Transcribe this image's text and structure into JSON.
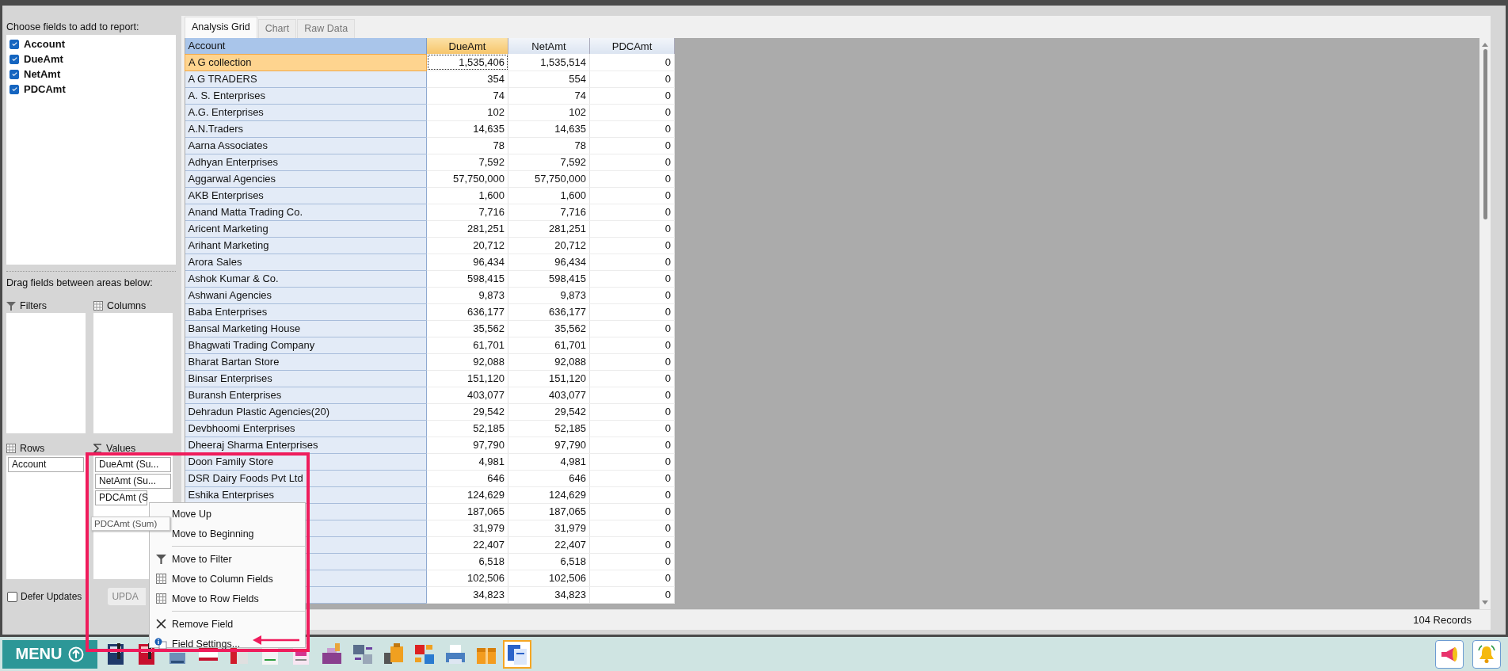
{
  "field_list": {
    "label": "Choose fields to add to report:",
    "fields": [
      {
        "name": "Account",
        "checked": true
      },
      {
        "name": "DueAmt",
        "checked": true
      },
      {
        "name": "NetAmt",
        "checked": true
      },
      {
        "name": "PDCAmt",
        "checked": true
      }
    ]
  },
  "areas_label": "Drag fields between areas below:",
  "areas": {
    "filters": {
      "label": "Filters"
    },
    "columns": {
      "label": "Columns"
    },
    "rows": {
      "label": "Rows",
      "items": [
        "Account"
      ]
    },
    "values": {
      "label": "Values",
      "items": [
        "DueAmt (Su...",
        "NetAmt (Su...",
        "PDCAmt (S"
      ]
    }
  },
  "defer_updates": {
    "label": "Defer Updates",
    "checked": false
  },
  "update_button": "UPDA",
  "tooltip": "PDCAmt (Sum)",
  "tabs": [
    {
      "label": "Analysis Grid",
      "selected": true
    },
    {
      "label": "Chart",
      "selected": false
    },
    {
      "label": "Raw Data",
      "selected": false
    }
  ],
  "grid": {
    "columns": [
      {
        "label": "Account",
        "selected": false
      },
      {
        "label": "DueAmt",
        "selected": true
      },
      {
        "label": "NetAmt",
        "selected": false
      },
      {
        "label": "PDCAmt",
        "selected": false
      }
    ],
    "rows": [
      {
        "account": "A G collection",
        "values": [
          "1,535,406",
          "1,535,514",
          "0"
        ],
        "selected": true
      },
      {
        "account": "A G TRADERS",
        "values": [
          "354",
          "554",
          "0"
        ],
        "selected": false
      },
      {
        "account": "A. S. Enterprises",
        "values": [
          "74",
          "74",
          "0"
        ],
        "selected": false
      },
      {
        "account": "A.G. Enterprises",
        "values": [
          "102",
          "102",
          "0"
        ],
        "selected": false
      },
      {
        "account": "A.N.Traders",
        "values": [
          "14,635",
          "14,635",
          "0"
        ],
        "selected": false
      },
      {
        "account": "Aarna Associates",
        "values": [
          "78",
          "78",
          "0"
        ],
        "selected": false
      },
      {
        "account": "Adhyan Enterprises",
        "values": [
          "7,592",
          "7,592",
          "0"
        ],
        "selected": false
      },
      {
        "account": "Aggarwal Agencies",
        "values": [
          "57,750,000",
          "57,750,000",
          "0"
        ],
        "selected": false
      },
      {
        "account": "AKB Enterprises",
        "values": [
          "1,600",
          "1,600",
          "0"
        ],
        "selected": false
      },
      {
        "account": "Anand Matta Trading Co.",
        "values": [
          "7,716",
          "7,716",
          "0"
        ],
        "selected": false
      },
      {
        "account": "Aricent Marketing",
        "values": [
          "281,251",
          "281,251",
          "0"
        ],
        "selected": false
      },
      {
        "account": "Arihant Marketing",
        "values": [
          "20,712",
          "20,712",
          "0"
        ],
        "selected": false
      },
      {
        "account": "Arora Sales",
        "values": [
          "96,434",
          "96,434",
          "0"
        ],
        "selected": false
      },
      {
        "account": "Ashok Kumar & Co.",
        "values": [
          "598,415",
          "598,415",
          "0"
        ],
        "selected": false
      },
      {
        "account": "Ashwani Agencies",
        "values": [
          "9,873",
          "9,873",
          "0"
        ],
        "selected": false
      },
      {
        "account": "Baba Enterprises",
        "values": [
          "636,177",
          "636,177",
          "0"
        ],
        "selected": false
      },
      {
        "account": "Bansal Marketing House",
        "values": [
          "35,562",
          "35,562",
          "0"
        ],
        "selected": false
      },
      {
        "account": "Bhagwati Trading Company",
        "values": [
          "61,701",
          "61,701",
          "0"
        ],
        "selected": false
      },
      {
        "account": "Bharat Bartan Store",
        "values": [
          "92,088",
          "92,088",
          "0"
        ],
        "selected": false
      },
      {
        "account": "Binsar Enterprises",
        "values": [
          "151,120",
          "151,120",
          "0"
        ],
        "selected": false
      },
      {
        "account": "Buransh Enterprises",
        "values": [
          "403,077",
          "403,077",
          "0"
        ],
        "selected": false
      },
      {
        "account": "Dehradun Plastic Agencies(20)",
        "values": [
          "29,542",
          "29,542",
          "0"
        ],
        "selected": false
      },
      {
        "account": "Devbhoomi Enterprises",
        "values": [
          "52,185",
          "52,185",
          "0"
        ],
        "selected": false
      },
      {
        "account": "Dheeraj Sharma Enterprises",
        "values": [
          "97,790",
          "97,790",
          "0"
        ],
        "selected": false
      },
      {
        "account": "Doon Family Store",
        "values": [
          "4,981",
          "4,981",
          "0"
        ],
        "selected": false
      },
      {
        "account": "DSR Dairy Foods Pvt Ltd",
        "values": [
          "646",
          "646",
          "0"
        ],
        "selected": false
      },
      {
        "account": "Eshika Enterprises",
        "values": [
          "124,629",
          "124,629",
          "0"
        ],
        "selected": false
      },
      {
        "values": [
          "187,065",
          "187,065",
          "0"
        ],
        "selected": false
      },
      {
        "values": [
          "31,979",
          "31,979",
          "0"
        ],
        "selected": false
      },
      {
        "values": [
          "22,407",
          "22,407",
          "0"
        ],
        "selected": false
      },
      {
        "values": [
          "6,518",
          "6,518",
          "0"
        ],
        "selected": false
      },
      {
        "values": [
          "102,506",
          "102,506",
          "0"
        ],
        "selected": false
      },
      {
        "values": [
          "34,823",
          "34,823",
          "0"
        ],
        "selected": false
      }
    ]
  },
  "status_bar": {
    "records": "104 Records"
  },
  "context_menu": {
    "groups": [
      [
        "Move Up",
        "Move to Beginning"
      ],
      [
        "Move to Filter",
        "Move to Column Fields",
        "Move to Row Fields"
      ],
      [
        "Remove Field",
        "Field Settings..."
      ]
    ]
  },
  "taskbar": {
    "menu_button": "MENU"
  }
}
